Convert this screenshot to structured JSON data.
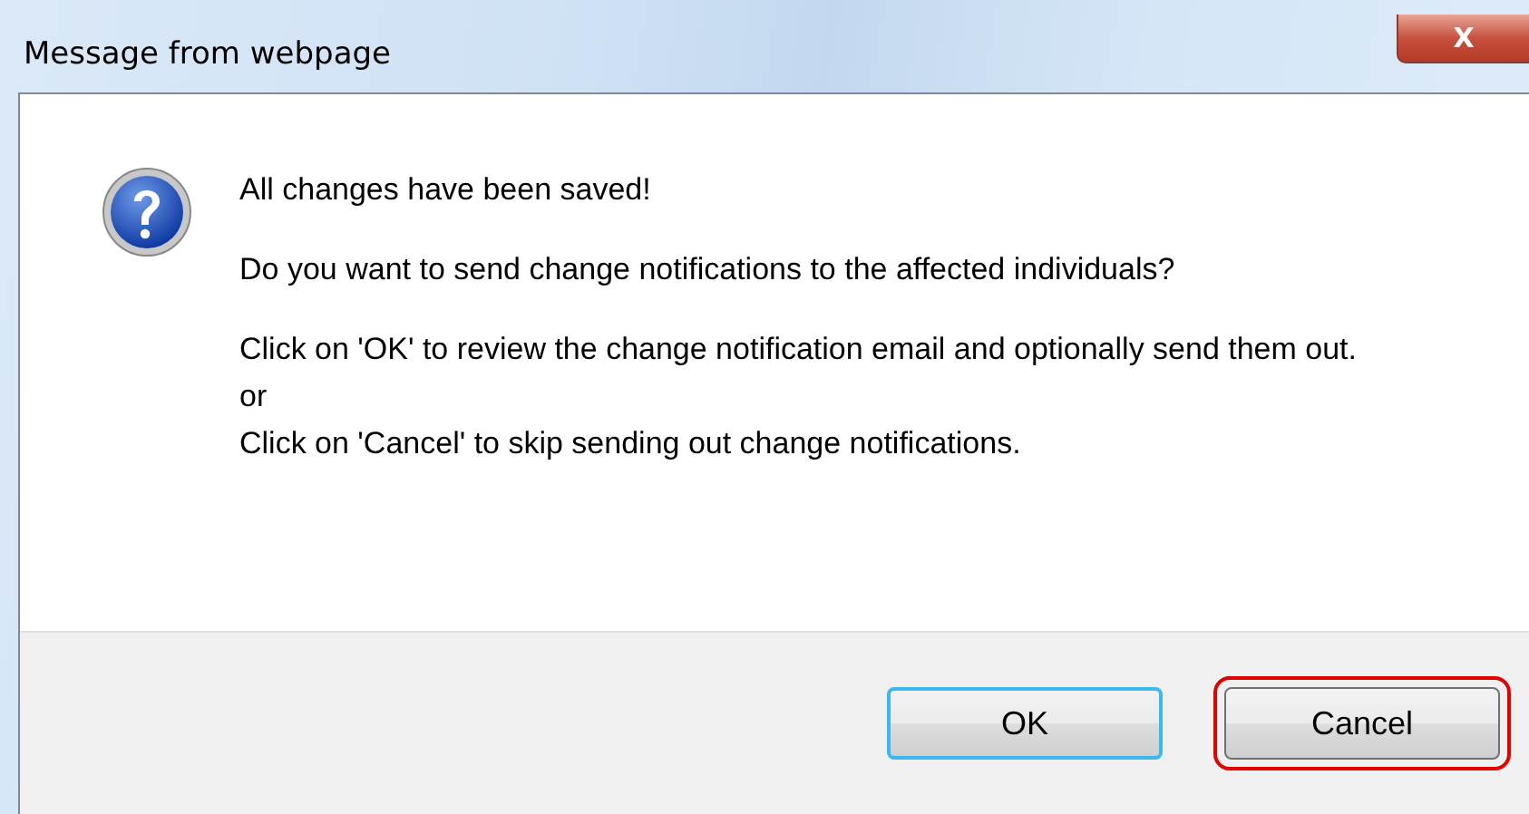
{
  "window": {
    "title": "Message from webpage",
    "close_label": "X"
  },
  "message": [
    "All changes have been saved!",
    "Do you want to send change notifications to the affected individuals?",
    "Click on 'OK' to review the change notification email and optionally send them out.",
    "or",
    "Click on 'Cancel' to skip sending out change notifications."
  ],
  "buttons": [
    {
      "label": "OK",
      "default": true,
      "highlighted": false
    },
    {
      "label": "Cancel",
      "default": false,
      "highlighted": true
    }
  ]
}
